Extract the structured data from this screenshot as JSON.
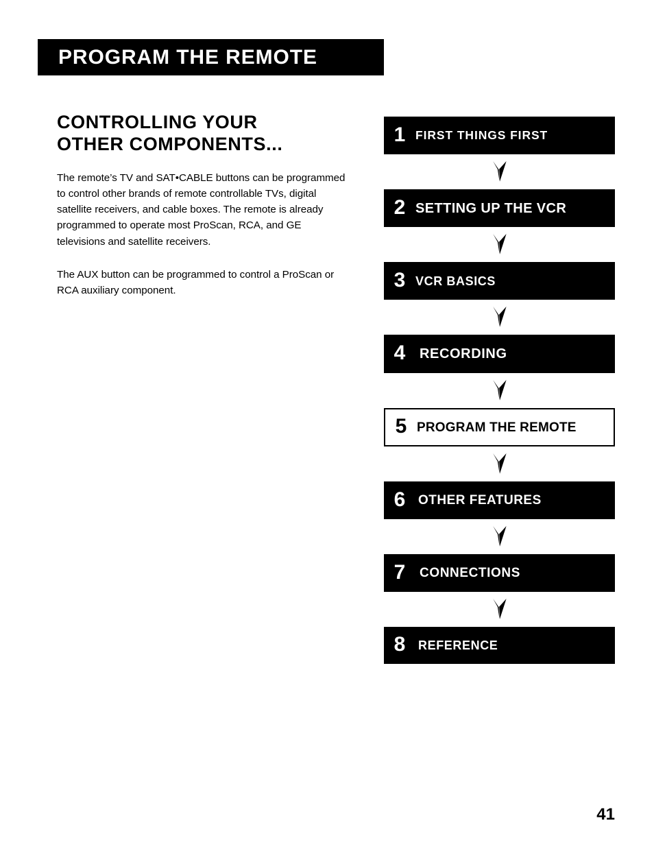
{
  "header": {
    "title": "PROGRAM THE REMOTE",
    "bar_color": "#000000",
    "text_color": "#ffffff"
  },
  "content": {
    "section_heading": "CONTROLLING YOUR\nOTHER COMPONENTS...",
    "paragraphs": [
      "The remote’s TV and SAT•CABLE buttons can be programmed to control other brands of remote controllable TVs,  digital satellite receivers, and cable boxes.  The remote is already programmed to operate most ProScan, RCA, and GE televisions and satellite receivers.",
      "The AUX button can be programmed to control a ProScan or RCA auxiliary component."
    ]
  },
  "flowchart": {
    "arrow_icon": "chevron-down-arrow",
    "items": [
      {
        "number": "1",
        "label": "FIRST THINGS FIRST",
        "current": false
      },
      {
        "number": "2",
        "label": "SETTING UP THE VCR",
        "current": false
      },
      {
        "number": "3",
        "label": "VCR BASICS",
        "current": false
      },
      {
        "number": "4",
        "label": "RECORDING",
        "current": false
      },
      {
        "number": "5",
        "label": "PROGRAM THE REMOTE",
        "current": true
      },
      {
        "number": "6",
        "label": "OTHER FEATURES",
        "current": false
      },
      {
        "number": "7",
        "label": "CONNECTIONS",
        "current": false
      },
      {
        "number": "8",
        "label": "REFERENCE",
        "current": false
      }
    ]
  },
  "footer": {
    "page_number": "41"
  }
}
